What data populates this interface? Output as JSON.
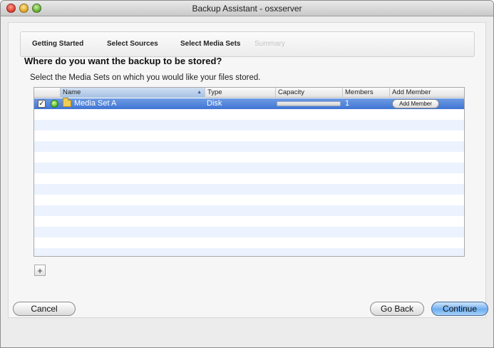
{
  "window": {
    "title": "Backup Assistant - osxserver"
  },
  "steps": [
    {
      "label": "Getting Started",
      "state": "done"
    },
    {
      "label": "Select Sources",
      "state": "done"
    },
    {
      "label": "Select Media Sets",
      "state": "current"
    },
    {
      "label": "Summary",
      "state": "disabled"
    }
  ],
  "main": {
    "heading": "Where do you want the backup to be stored?",
    "subheading": "Select the Media Sets on which you would like your files stored."
  },
  "table": {
    "columns": [
      "",
      "Name",
      "Type",
      "Capacity",
      "Members",
      "Add Member"
    ],
    "sorted_column": "Name",
    "rows": [
      {
        "checked": true,
        "checkbox_glyph": "✓",
        "status_icon": "green-status-icon",
        "icon": "folder-icon",
        "name": "Media Set A",
        "type": "Disk",
        "capacity_fill": 0,
        "members": "1",
        "add_member_label": "Add Member",
        "selected": true
      }
    ]
  },
  "toolbar": {
    "plus_label": "+"
  },
  "footer": {
    "cancel_label": "Cancel",
    "back_label": "Go Back",
    "continue_label": "Continue"
  },
  "colors": {
    "selection": "#3f74d4",
    "stripe": "#edf3fe",
    "default_button": "#6eaef0"
  }
}
